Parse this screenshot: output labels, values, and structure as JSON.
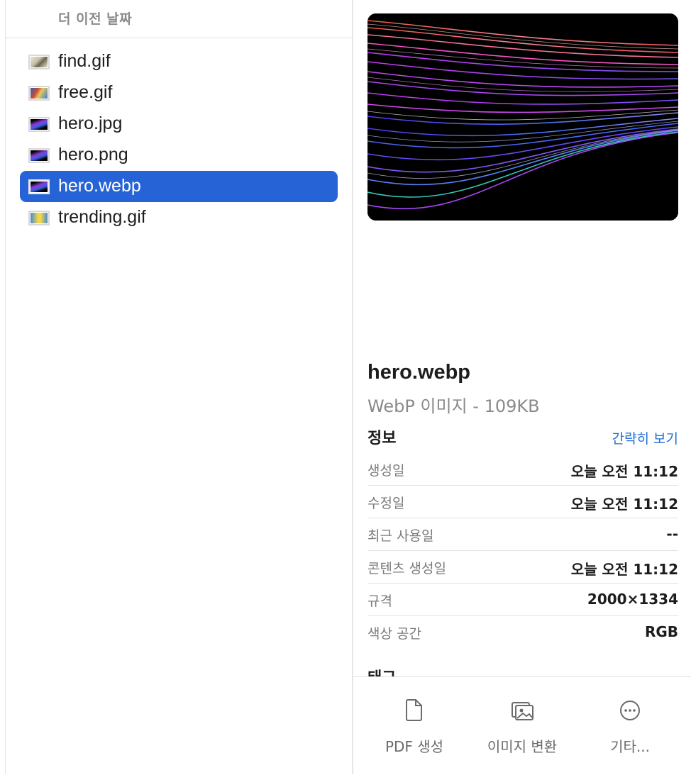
{
  "file_list": {
    "group_header": "더 이전 날짜",
    "files": [
      {
        "name": "find.gif",
        "icon": "gif-thumbnail-icon",
        "selected": false
      },
      {
        "name": "free.gif",
        "icon": "gif-thumbnail-icon",
        "selected": false
      },
      {
        "name": "hero.jpg",
        "icon": "image-thumbnail-icon",
        "selected": false
      },
      {
        "name": "hero.png",
        "icon": "image-thumbnail-icon",
        "selected": false
      },
      {
        "name": "hero.webp",
        "icon": "image-thumbnail-icon",
        "selected": true
      },
      {
        "name": "trending.gif",
        "icon": "gif-thumbnail-icon",
        "selected": false
      }
    ]
  },
  "preview": {
    "filename": "hero.webp",
    "kind_size": "WebP 이미지 - 109KB"
  },
  "info": {
    "section_title": "정보",
    "toggle_link": "간략히 보기",
    "rows": [
      {
        "label": "생성일",
        "value": "오늘 오전 11:12"
      },
      {
        "label": "수정일",
        "value": "오늘 오전 11:12"
      },
      {
        "label": "최근 사용일",
        "value": "--"
      },
      {
        "label": "콘텐츠 생성일",
        "value": "오늘 오전 11:12"
      },
      {
        "label": "규격",
        "value": "2000×1334"
      },
      {
        "label": "색상 공간",
        "value": "RGB"
      }
    ],
    "next_section_partial": "태그"
  },
  "actions": [
    {
      "label": "PDF 생성",
      "icon": "document-icon"
    },
    {
      "label": "이미지 변환",
      "icon": "photos-icon"
    },
    {
      "label": "기타...",
      "icon": "more-icon"
    }
  ],
  "colors": {
    "selection": "#2563d6",
    "link": "#1f6fd6"
  }
}
